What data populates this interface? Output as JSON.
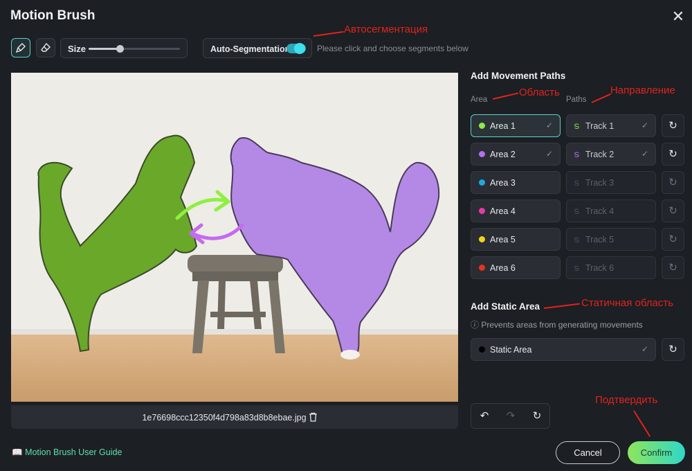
{
  "dialog": {
    "title": "Motion Brush"
  },
  "toolbar": {
    "size_label": "Size",
    "size_value": 0.34,
    "autoseg_label": "Auto-Segmentation",
    "autoseg_on": true,
    "hint": "Please click and choose segments below"
  },
  "annotations": {
    "autoseg": "Автосегментация",
    "area": "Область",
    "direction": "Направление",
    "static": "Статичная область",
    "confirm": "Подтвердить"
  },
  "canvas": {
    "file_name": "1e76698ccc12350f4d798a83d8b8ebae.jpg"
  },
  "movement": {
    "title": "Add Movement Paths",
    "area_col": "Area",
    "paths_col": "Paths",
    "rows": [
      {
        "area": "Area 1",
        "track": "Track 1",
        "color": "#8ee84a",
        "checked": true,
        "selected": true,
        "track_color": "#7fe05a"
      },
      {
        "area": "Area 2",
        "track": "Track 2",
        "color": "#b46ef0",
        "checked": true,
        "selected": false,
        "track_color": "#b46ef0"
      },
      {
        "area": "Area 3",
        "track": "Track 3",
        "color": "#22a6e8",
        "checked": false,
        "selected": false
      },
      {
        "area": "Area 4",
        "track": "Track 4",
        "color": "#e83aa6",
        "checked": false,
        "selected": false
      },
      {
        "area": "Area 5",
        "track": "Track 5",
        "color": "#f0d21e",
        "checked": false,
        "selected": false
      },
      {
        "area": "Area 6",
        "track": "Track 6",
        "color": "#e8321e",
        "checked": false,
        "selected": false
      }
    ]
  },
  "static": {
    "title": "Add Static Area",
    "info": "Prevents areas from generating movements",
    "label": "Static Area",
    "color": "#000000"
  },
  "footer": {
    "guide": "Motion Brush User Guide",
    "cancel": "Cancel",
    "confirm": "Confirm"
  }
}
